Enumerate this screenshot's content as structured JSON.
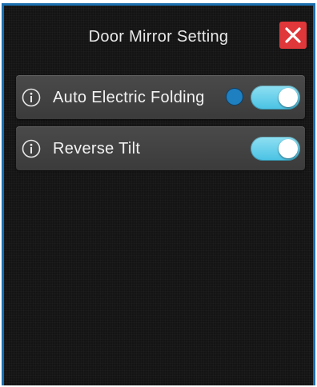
{
  "header": {
    "title": "Door Mirror Setting",
    "close_icon": "close-icon",
    "accent_color": "#e0373a"
  },
  "settings": [
    {
      "label": "Auto Electric Folding",
      "info_icon": "info-icon",
      "indicator_color": "#1e7fc1",
      "toggle_on": true
    },
    {
      "label": "Reverse Tilt",
      "info_icon": "info-icon",
      "toggle_on": true
    }
  ],
  "colors": {
    "toggle_on": "#49c2e4",
    "background": "#141414",
    "frame_border": "#1b6fb0"
  }
}
